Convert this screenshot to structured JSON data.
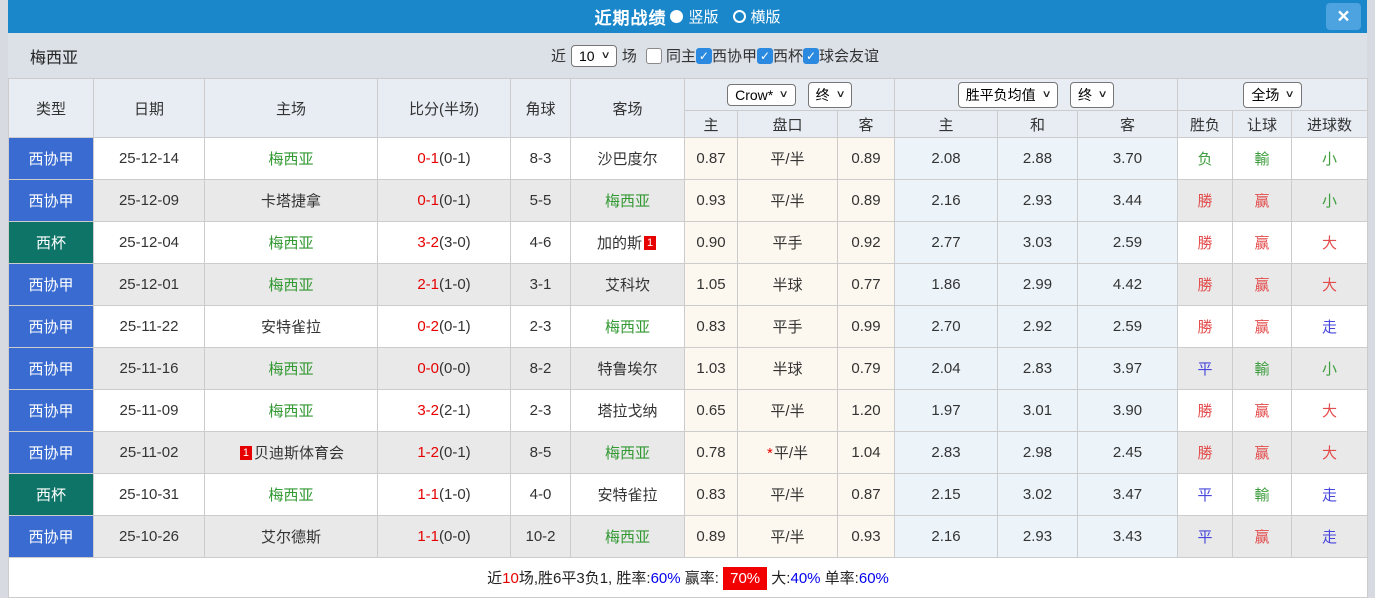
{
  "titlebar": {
    "title": "近期战绩",
    "radio_vertical": "竖版",
    "radio_horizontal": "横版",
    "close_label": "×"
  },
  "filterbar": {
    "team_name": "梅西亚",
    "near_label": "近",
    "matches_count": "10",
    "matches_label": "场",
    "same_home_label": "同主",
    "league_filters": [
      "西协甲",
      "西杯",
      "球会友谊"
    ]
  },
  "table": {
    "left_headers": [
      "类型",
      "日期",
      "主场",
      "比分(半场)",
      "角球",
      "客场"
    ],
    "sub_headers": [
      "主",
      "盘口",
      "客",
      "主",
      "和",
      "客",
      "胜负",
      "让球",
      "进球数"
    ],
    "selects": {
      "odds_source": "Crow*",
      "odds_time": "终",
      "avg_metric": "胜平负均值",
      "avg_time": "终",
      "scope": "全场"
    },
    "rows": [
      {
        "type": "西协甲",
        "cup": false,
        "date": "25-12-14",
        "home": {
          "name": "梅西亚",
          "self": true
        },
        "score": {
          "ft": "0-1",
          "ht": "(0-1)"
        },
        "corner": "8-3",
        "away": {
          "name": "沙巴度尔",
          "self": false
        },
        "odds": [
          "0.87",
          "平/半",
          "0.89"
        ],
        "odds_star": false,
        "avg": [
          "2.08",
          "2.88",
          "3.70"
        ],
        "res": [
          {
            "t": "负",
            "c": "g"
          },
          {
            "t": "輸",
            "c": "g"
          },
          {
            "t": "小",
            "c": "g"
          }
        ]
      },
      {
        "type": "西协甲",
        "cup": false,
        "date": "25-12-09",
        "home": {
          "name": "卡塔捷拿",
          "self": false
        },
        "score": {
          "ft": "0-1",
          "ht": "(0-1)"
        },
        "corner": "5-5",
        "away": {
          "name": "梅西亚",
          "self": true
        },
        "odds": [
          "0.93",
          "平/半",
          "0.89"
        ],
        "odds_star": false,
        "avg": [
          "2.16",
          "2.93",
          "3.44"
        ],
        "res": [
          {
            "t": "勝",
            "c": "r"
          },
          {
            "t": "赢",
            "c": "r"
          },
          {
            "t": "小",
            "c": "g"
          }
        ]
      },
      {
        "type": "西杯",
        "cup": true,
        "date": "25-12-04",
        "home": {
          "name": "梅西亚",
          "self": true
        },
        "score": {
          "ft": "3-2",
          "ht": "(3-0)"
        },
        "corner": "4-6",
        "away": {
          "name": "加的斯",
          "self": false,
          "rank": "1",
          "rank_pos": "after"
        },
        "odds": [
          "0.90",
          "平手",
          "0.92"
        ],
        "odds_star": false,
        "avg": [
          "2.77",
          "3.03",
          "2.59"
        ],
        "res": [
          {
            "t": "勝",
            "c": "r"
          },
          {
            "t": "赢",
            "c": "r"
          },
          {
            "t": "大",
            "c": "r"
          }
        ]
      },
      {
        "type": "西协甲",
        "cup": false,
        "date": "25-12-01",
        "home": {
          "name": "梅西亚",
          "self": true
        },
        "score": {
          "ft": "2-1",
          "ht": "(1-0)"
        },
        "corner": "3-1",
        "away": {
          "name": "艾科坎",
          "self": false
        },
        "odds": [
          "1.05",
          "半球",
          "0.77"
        ],
        "odds_star": false,
        "avg": [
          "1.86",
          "2.99",
          "4.42"
        ],
        "res": [
          {
            "t": "勝",
            "c": "r"
          },
          {
            "t": "赢",
            "c": "r"
          },
          {
            "t": "大",
            "c": "r"
          }
        ]
      },
      {
        "type": "西协甲",
        "cup": false,
        "date": "25-11-22",
        "home": {
          "name": "安特雀拉",
          "self": false
        },
        "score": {
          "ft": "0-2",
          "ht": "(0-1)"
        },
        "corner": "2-3",
        "away": {
          "name": "梅西亚",
          "self": true
        },
        "odds": [
          "0.83",
          "平手",
          "0.99"
        ],
        "odds_star": false,
        "avg": [
          "2.70",
          "2.92",
          "2.59"
        ],
        "res": [
          {
            "t": "勝",
            "c": "r"
          },
          {
            "t": "赢",
            "c": "r"
          },
          {
            "t": "走",
            "c": "b"
          }
        ]
      },
      {
        "type": "西协甲",
        "cup": false,
        "date": "25-11-16",
        "home": {
          "name": "梅西亚",
          "self": true
        },
        "score": {
          "ft": "0-0",
          "ht": "(0-0)"
        },
        "corner": "8-2",
        "away": {
          "name": "特鲁埃尔",
          "self": false
        },
        "odds": [
          "1.03",
          "半球",
          "0.79"
        ],
        "odds_star": false,
        "avg": [
          "2.04",
          "2.83",
          "3.97"
        ],
        "res": [
          {
            "t": "平",
            "c": "b"
          },
          {
            "t": "輸",
            "c": "g"
          },
          {
            "t": "小",
            "c": "g"
          }
        ]
      },
      {
        "type": "西协甲",
        "cup": false,
        "date": "25-11-09",
        "home": {
          "name": "梅西亚",
          "self": true
        },
        "score": {
          "ft": "3-2",
          "ht": "(2-1)"
        },
        "corner": "2-3",
        "away": {
          "name": "塔拉戈纳",
          "self": false
        },
        "odds": [
          "0.65",
          "平/半",
          "1.20"
        ],
        "odds_star": false,
        "avg": [
          "1.97",
          "3.01",
          "3.90"
        ],
        "res": [
          {
            "t": "勝",
            "c": "r"
          },
          {
            "t": "赢",
            "c": "r"
          },
          {
            "t": "大",
            "c": "r"
          }
        ]
      },
      {
        "type": "西协甲",
        "cup": false,
        "date": "25-11-02",
        "home": {
          "name": "贝迪斯体育会",
          "self": false,
          "rank": "1",
          "rank_pos": "before"
        },
        "score": {
          "ft": "1-2",
          "ht": "(0-1)"
        },
        "corner": "8-5",
        "away": {
          "name": "梅西亚",
          "self": true
        },
        "odds": [
          "0.78",
          "平/半",
          "1.04"
        ],
        "odds_star": true,
        "avg": [
          "2.83",
          "2.98",
          "2.45"
        ],
        "res": [
          {
            "t": "勝",
            "c": "r"
          },
          {
            "t": "赢",
            "c": "r"
          },
          {
            "t": "大",
            "c": "r"
          }
        ]
      },
      {
        "type": "西杯",
        "cup": true,
        "date": "25-10-31",
        "home": {
          "name": "梅西亚",
          "self": true
        },
        "score": {
          "ft": "1-1",
          "ht": "(1-0)"
        },
        "corner": "4-0",
        "away": {
          "name": "安特雀拉",
          "self": false
        },
        "odds": [
          "0.83",
          "平/半",
          "0.87"
        ],
        "odds_star": false,
        "avg": [
          "2.15",
          "3.02",
          "3.47"
        ],
        "res": [
          {
            "t": "平",
            "c": "b"
          },
          {
            "t": "輸",
            "c": "g"
          },
          {
            "t": "走",
            "c": "b"
          }
        ]
      },
      {
        "type": "西协甲",
        "cup": false,
        "date": "25-10-26",
        "home": {
          "name": "艾尔德斯",
          "self": false
        },
        "score": {
          "ft": "1-1",
          "ht": "(0-0)"
        },
        "corner": "10-2",
        "away": {
          "name": "梅西亚",
          "self": true
        },
        "odds": [
          "0.89",
          "平/半",
          "0.93"
        ],
        "odds_star": false,
        "avg": [
          "2.16",
          "2.93",
          "3.43"
        ],
        "res": [
          {
            "t": "平",
            "c": "b"
          },
          {
            "t": "赢",
            "c": "r"
          },
          {
            "t": "走",
            "c": "b"
          }
        ]
      }
    ]
  },
  "summary": {
    "parts": [
      {
        "t": "近",
        "c": "k"
      },
      {
        "t": "10",
        "c": "r"
      },
      {
        "t": "场,胜6平3负1, 胜率:",
        "c": "k"
      },
      {
        "t": "60%",
        "c": "b"
      },
      {
        "t": " 赢率: ",
        "c": "k"
      },
      {
        "t": "70%",
        "c": "hl"
      },
      {
        "t": " 大:",
        "c": "k"
      },
      {
        "t": "40%",
        "c": "b"
      },
      {
        "t": " 单率:",
        "c": "k"
      },
      {
        "t": "60%",
        "c": "b"
      }
    ]
  },
  "colors": {
    "titlebar_blue": "#1987ca",
    "close_button_blue": "#4da3df",
    "league_badge_blue": "#3a6bd0",
    "cup_badge_teal": "#0e7467",
    "self_team_green": "#339933",
    "score_red": "#e60000",
    "result_red": "#e34c4c",
    "result_green": "#3f9e3f",
    "result_blue": "#4646dc",
    "summary_percent_blue": "#0000ee",
    "summary_highlight_red": "#f20000",
    "odds_column_cream": "#fdf8ef",
    "avg_column_blue": "#ecf4fa",
    "checkbox_blue": "#2b8ae0"
  }
}
